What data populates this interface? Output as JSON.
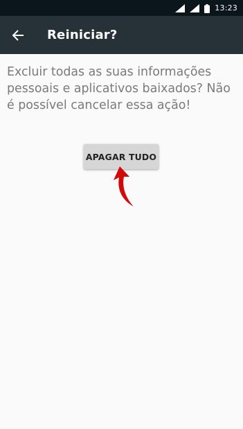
{
  "status_bar": {
    "time": "13:23",
    "icons": [
      "signal-icon",
      "wifi-signal-icon",
      "battery-icon"
    ]
  },
  "app_bar": {
    "back_icon": "arrow-left-icon",
    "title": "Reiniciar?"
  },
  "content": {
    "message": "Excluir todas as suas informações pessoais e aplicativos baixados? Não é possível cancelar essa ação!"
  },
  "actions": {
    "erase_all_label": "APAGAR TUDO"
  },
  "colors": {
    "status_bar": "#0b161c",
    "app_bar": "#263238",
    "background": "#fafafa",
    "annotation_arrow": "#d10a0a"
  }
}
